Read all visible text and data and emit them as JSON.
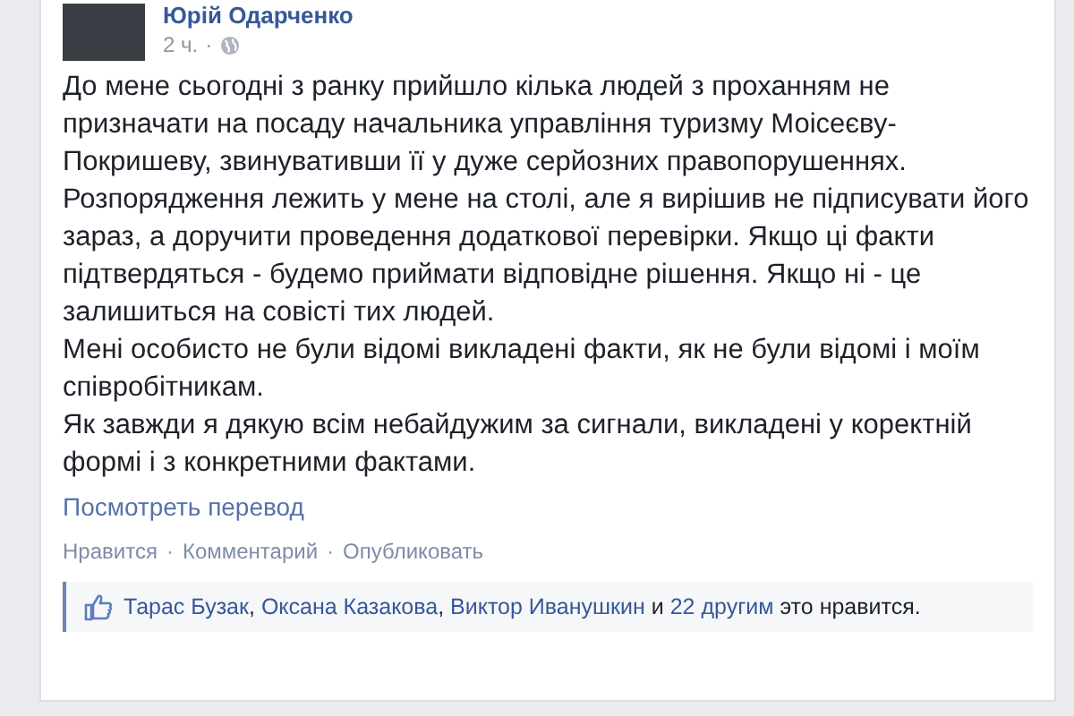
{
  "post": {
    "author": "Юрій Одарченко",
    "time": "2 ч.",
    "separator": "·",
    "paragraphs": [
      "До мене сьогодні з ранку прийшло кілька людей з проханням не призначати на посаду начальника управління туризму Моісеєву-Покришеву, звинувативши її у дуже серйозних правопорушеннях.",
      "Розпорядження лежить у мене на столі, але я вирішив не підписувати його зараз, а доручити проведення додаткової перевірки. Якщо ці факти підтвердяться - будемо приймати відповідне рішення. Якщо ні - це залишиться на совісті тих людей.",
      "Мені особисто не були відомі викладені факти, як не були відомі і моїм співробітникам.",
      "Як завжди я дякую всім небайдужим за сигнали, викладені у коректній формі і з конкретними фактами."
    ],
    "translate_link": "Посмотреть перевод",
    "actions": [
      "Нравится",
      "Комментарий",
      "Опубликовать"
    ],
    "likes": {
      "names": [
        "Тарас Бузак",
        "Оксана Казакова",
        "Виктор Иванушкин"
      ],
      "list_separator": ",",
      "conjunction": "и",
      "others": "22 другим",
      "suffix": "это нравится."
    }
  }
}
